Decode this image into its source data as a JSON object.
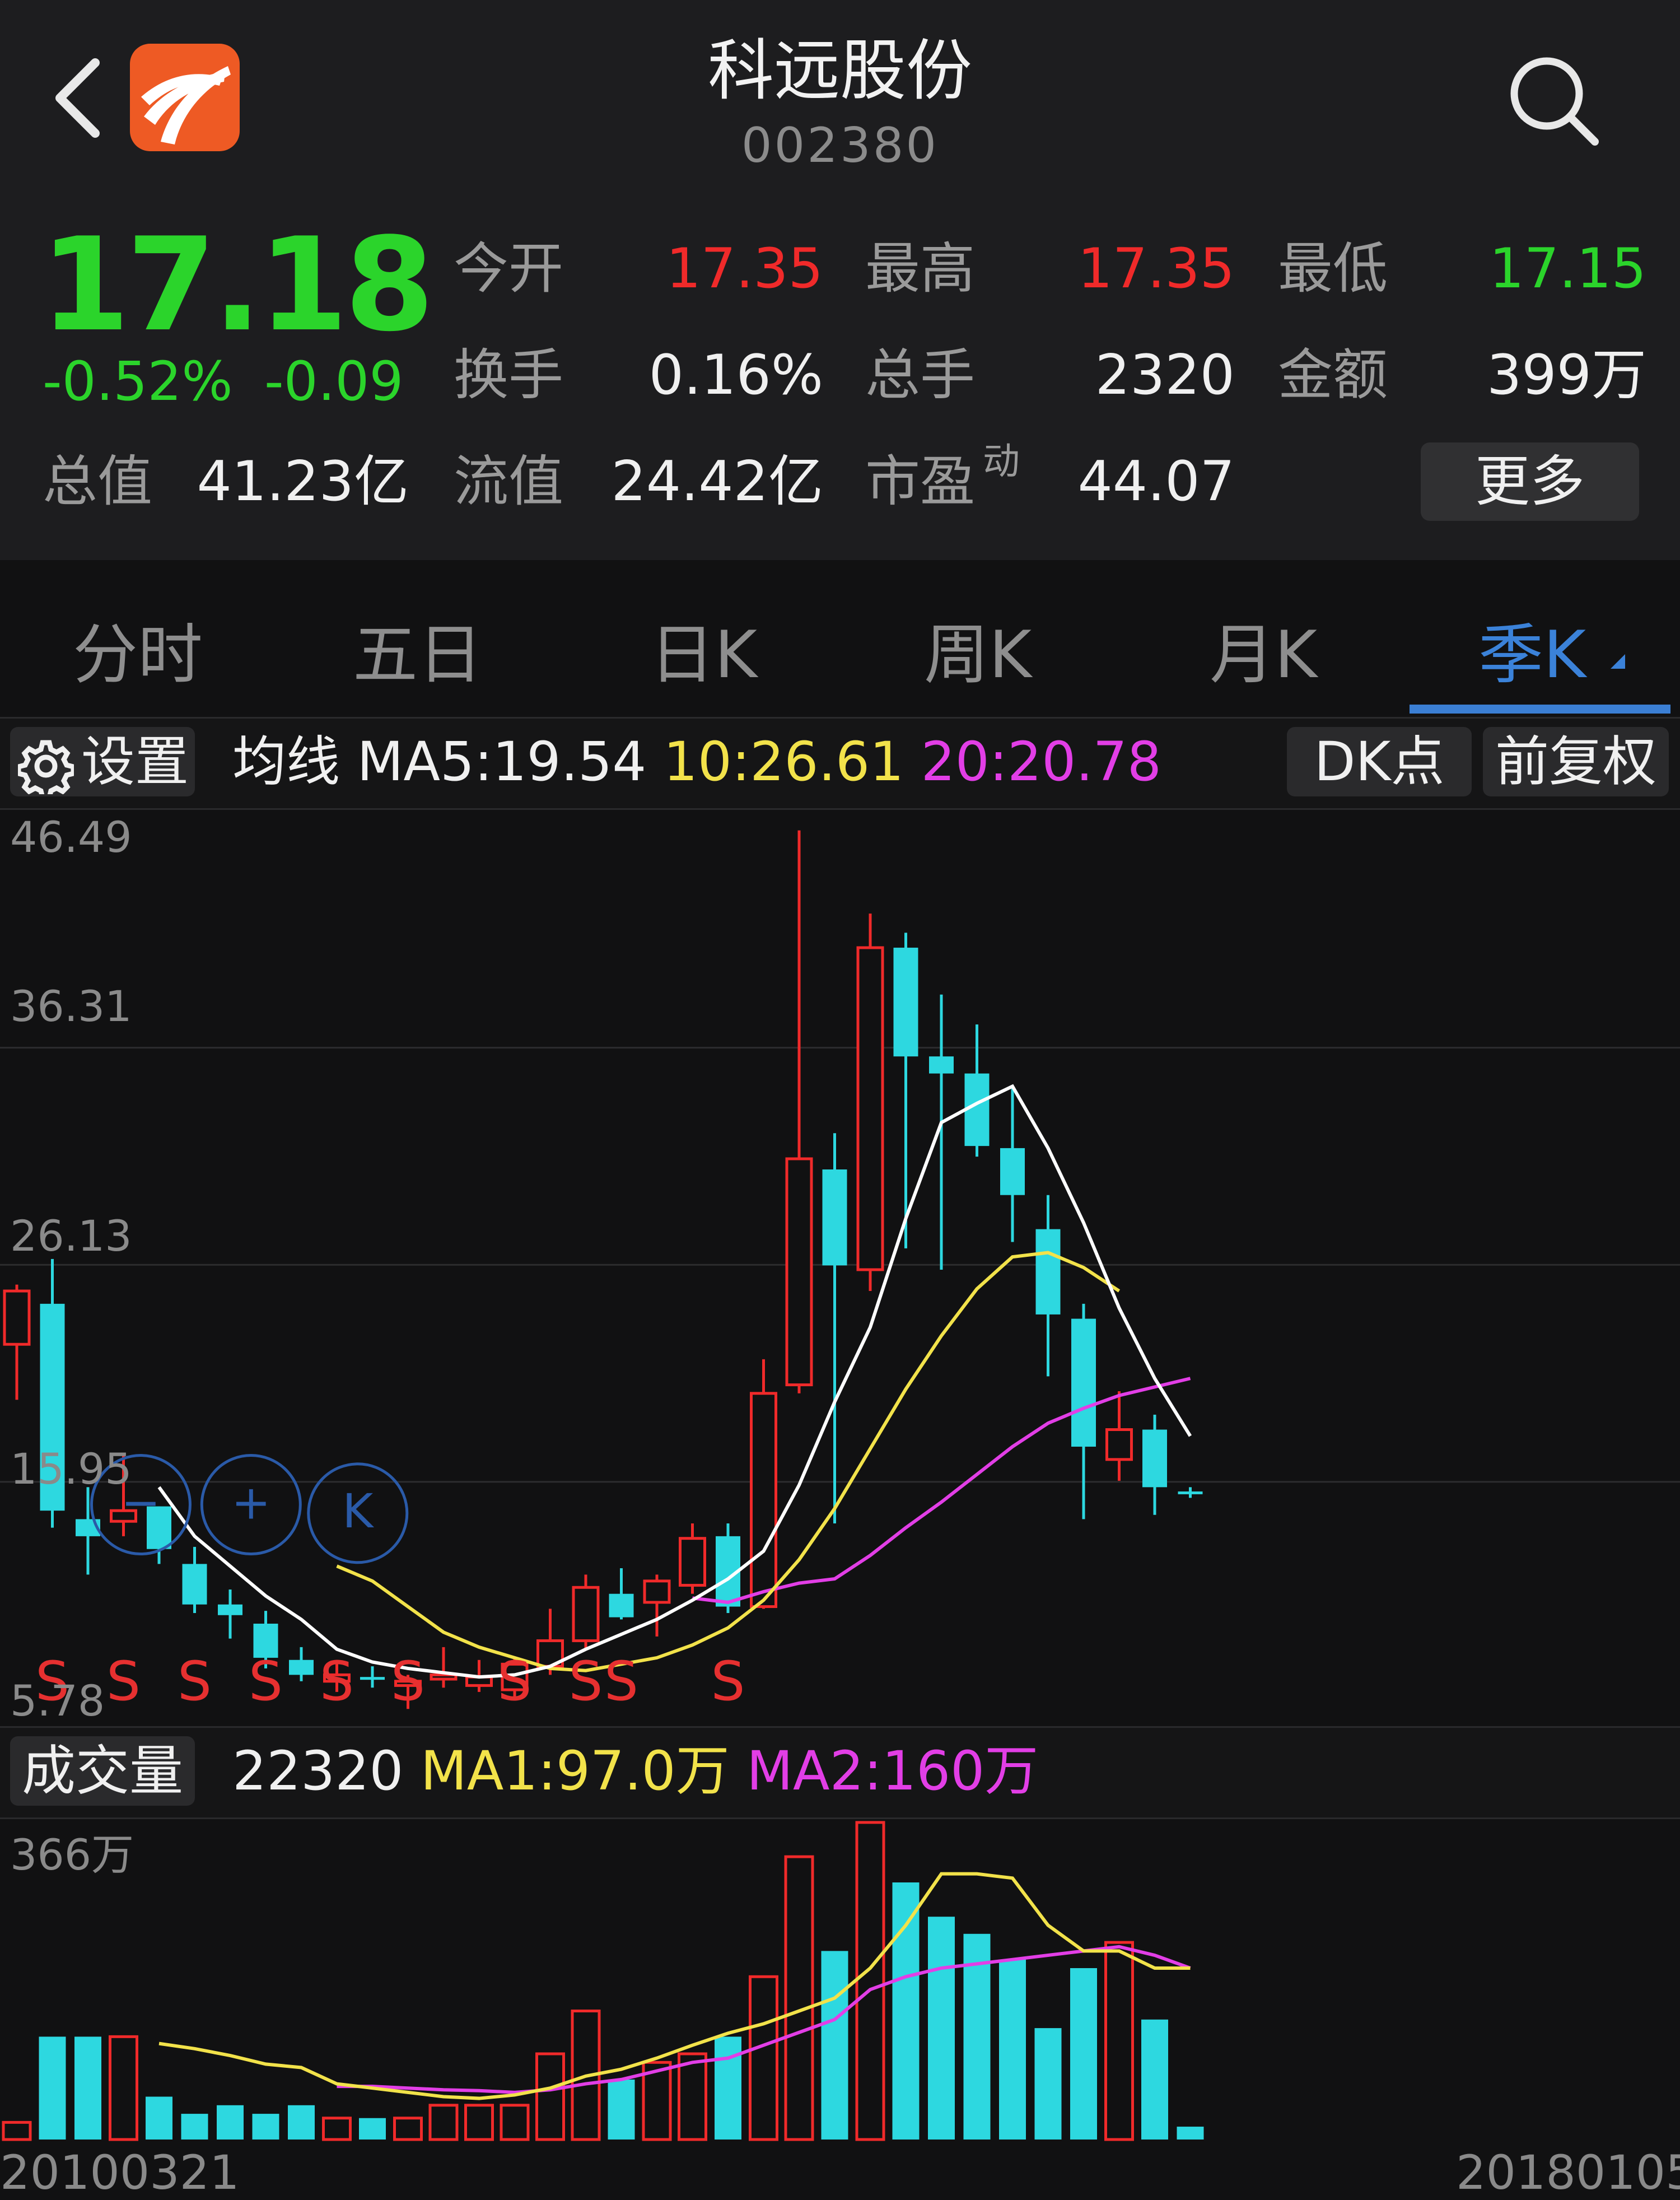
{
  "header": {
    "stock_name": "科远股份",
    "stock_code": "002380",
    "icons": {
      "back": "chevron-left-icon",
      "logo": "app-logo-icon",
      "search": "search-icon"
    }
  },
  "quote": {
    "price": "17.18",
    "change_pct": "-0.52%",
    "change": "-0.09",
    "open_label": "今开",
    "open": "17.35",
    "high_label": "最高",
    "high": "17.35",
    "low_label": "最低",
    "low": "17.15",
    "turnover_label": "换手",
    "turnover": "0.16%",
    "volume_label": "总手",
    "volume": "2320",
    "amount_label": "金额",
    "amount": "399万",
    "mktcap_label": "总值",
    "mktcap": "41.23亿",
    "float_label": "流值",
    "float_cap": "24.42亿",
    "pe_label": "市盈",
    "pe_sup": "动",
    "pe": "44.07",
    "more_label": "更多",
    "colors": {
      "up": "#f02a2a",
      "down": "#2bd42b"
    }
  },
  "tabs": [
    {
      "label": "分时",
      "active": false
    },
    {
      "label": "五日",
      "active": false
    },
    {
      "label": "日K",
      "active": false
    },
    {
      "label": "周K",
      "active": false
    },
    {
      "label": "月K",
      "active": false
    },
    {
      "label": "季K",
      "active": true
    }
  ],
  "chart_toolbar": {
    "settings_label": "设置",
    "ma_title": "均线",
    "ma5": "MA5:19.54",
    "ma10": "10:26.61",
    "ma20": "20:20.78",
    "dk_label": "DK点",
    "adjust_label": "前复权",
    "icon_settings": "gear-icon"
  },
  "volume_toolbar": {
    "label": "成交量",
    "value": "22320",
    "ma1": "MA1:97.0万",
    "ma2": "MA2:160万"
  },
  "date_left": "20100321",
  "date_right": "20180105",
  "chart_data": [
    {
      "type": "candlestick",
      "y_ticks": [
        "46.49",
        "36.31",
        "26.13",
        "15.95",
        "5.78"
      ],
      "ylim": [
        5.78,
        46.49
      ],
      "grid": true,
      "candles": [
        [
          22.4,
          25.2,
          19.8,
          24.9
        ],
        [
          24.3,
          26.4,
          13.8,
          14.6
        ],
        [
          14.2,
          15.7,
          11.6,
          13.4
        ],
        [
          14.1,
          17.3,
          13.4,
          14.6
        ],
        [
          14.8,
          14.8,
          12.1,
          12.8
        ],
        [
          12.1,
          12.9,
          9.8,
          10.2
        ],
        [
          10.2,
          10.9,
          8.6,
          9.7
        ],
        [
          9.3,
          9.9,
          7.2,
          7.7
        ],
        [
          7.6,
          8.2,
          6.6,
          6.9
        ],
        [
          6.6,
          7.6,
          6.1,
          6.9
        ],
        [
          6.8,
          7.3,
          6.3,
          6.7
        ],
        [
          6.4,
          6.9,
          5.3,
          6.6
        ],
        [
          6.7,
          8.2,
          6.3,
          6.9
        ],
        [
          6.4,
          7.6,
          6.1,
          6.8
        ],
        [
          6.2,
          7.7,
          5.8,
          7.4
        ],
        [
          7.3,
          10.0,
          6.9,
          8.5
        ],
        [
          8.5,
          11.6,
          8.1,
          11.0
        ],
        [
          10.7,
          11.9,
          9.5,
          9.6
        ],
        [
          10.3,
          11.6,
          8.7,
          11.3
        ],
        [
          11.1,
          14.0,
          10.7,
          13.3
        ],
        [
          13.4,
          14.0,
          9.8,
          10.1
        ],
        [
          10.1,
          21.7,
          10.0,
          20.1
        ],
        [
          20.5,
          46.5,
          20.1,
          31.1
        ],
        [
          30.6,
          32.3,
          14.0,
          26.1
        ],
        [
          25.9,
          42.6,
          24.9,
          41.0
        ],
        [
          41.0,
          41.7,
          26.9,
          35.9
        ],
        [
          35.9,
          38.8,
          25.9,
          35.1
        ],
        [
          35.1,
          37.4,
          31.2,
          31.7
        ],
        [
          31.6,
          34.5,
          27.2,
          29.4
        ],
        [
          27.8,
          29.4,
          20.9,
          23.8
        ],
        [
          23.6,
          24.3,
          14.2,
          17.6
        ],
        [
          17.0,
          20.2,
          16.0,
          18.4
        ],
        [
          18.4,
          19.1,
          14.4,
          15.7
        ],
        [
          15.5,
          15.7,
          15.2,
          15.4
        ]
      ],
      "ma5": [
        null,
        null,
        null,
        null,
        15.7,
        13.4,
        12.0,
        10.6,
        9.5,
        8.1,
        7.5,
        7.2,
        7.0,
        6.8,
        6.9,
        7.3,
        8.1,
        8.8,
        9.5,
        10.4,
        11.4,
        12.7,
        15.8,
        19.7,
        23.2,
        28.3,
        32.8,
        33.7,
        34.5,
        31.6,
        28.1,
        24.1,
        20.8,
        18.1
      ],
      "ma10": [
        null,
        null,
        null,
        null,
        null,
        null,
        null,
        null,
        null,
        12.0,
        11.3,
        10.1,
        8.9,
        8.2,
        7.7,
        7.2,
        7.1,
        7.4,
        7.7,
        8.3,
        9.1,
        10.4,
        12.3,
        14.7,
        17.5,
        20.3,
        22.8,
        25.0,
        26.5,
        26.7,
        26.0,
        24.9
      ],
      "ma20": [
        null,
        null,
        null,
        null,
        null,
        null,
        null,
        null,
        null,
        null,
        null,
        null,
        null,
        null,
        null,
        null,
        null,
        null,
        null,
        10.5,
        10.3,
        10.8,
        11.2,
        11.4,
        12.5,
        13.8,
        15.0,
        16.3,
        17.6,
        18.7,
        19.4,
        20.0,
        20.4,
        20.8
      ],
      "s_marks": [
        1,
        3,
        5,
        7,
        9,
        11,
        14,
        16,
        17,
        20
      ],
      "circle_markers": [
        {
          "index": 2.7,
          "y": 7.0,
          "symbol": "−"
        },
        {
          "index": 5.8,
          "y": 7.0,
          "symbol": "+"
        },
        {
          "index": 8.8,
          "y": 6.6,
          "symbol": "K"
        }
      ]
    },
    {
      "type": "bar",
      "y_ticks": [
        "366万"
      ],
      "ylim": [
        0,
        366
      ],
      "unit": "万",
      "values": [
        20,
        120,
        120,
        120,
        50,
        30,
        40,
        30,
        40,
        25,
        25,
        25,
        40,
        40,
        40,
        100,
        150,
        70,
        90,
        100,
        120,
        190,
        330,
        220,
        370,
        300,
        260,
        240,
        210,
        130,
        200,
        230,
        140,
        15
      ],
      "ma1": [
        null,
        null,
        null,
        null,
        112,
        106,
        98,
        88,
        84,
        65,
        60,
        55,
        50,
        48,
        52,
        60,
        74,
        82,
        95,
        110,
        124,
        135,
        150,
        165,
        200,
        250,
        310,
        310,
        305,
        250,
        220,
        220,
        200,
        200
      ],
      "ma2": [
        null,
        null,
        null,
        null,
        null,
        null,
        null,
        null,
        null,
        62,
        62,
        60,
        58,
        57,
        55,
        58,
        65,
        70,
        80,
        90,
        95,
        110,
        125,
        140,
        175,
        190,
        200,
        205,
        210,
        215,
        220,
        225,
        215,
        200
      ]
    }
  ]
}
